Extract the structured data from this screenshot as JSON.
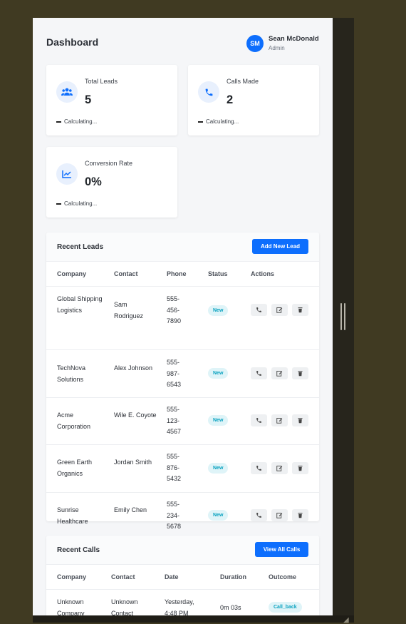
{
  "header": {
    "title": "Dashboard",
    "user": {
      "initials": "SM",
      "name": "Sean McDonald",
      "role": "Admin"
    }
  },
  "stats": [
    {
      "label": "Total Leads",
      "value": "5",
      "trend": "Calculating...",
      "icon": "users-icon"
    },
    {
      "label": "Calls Made",
      "value": "2",
      "trend": "Calculating...",
      "icon": "phone-icon"
    },
    {
      "label": "Conversion Rate",
      "value": "0%",
      "trend": "Calculating...",
      "icon": "chart-line-icon"
    }
  ],
  "recent_leads": {
    "title": "Recent Leads",
    "add_button": "Add New Lead",
    "columns": [
      "Company",
      "Contact",
      "Phone",
      "Status",
      "Actions"
    ],
    "rows": [
      {
        "company": "Global Shipping Logistics",
        "contact": "Sam Rodriguez",
        "phone": "555-456-7890",
        "status": "New"
      },
      {
        "company": "TechNova Solutions",
        "contact": "Alex Johnson",
        "phone": "555-987-6543",
        "status": "New"
      },
      {
        "company": "Acme Corporation",
        "contact": "Wile E. Coyote",
        "phone": "555-123-4567",
        "status": "New"
      },
      {
        "company": "Green Earth Organics",
        "contact": "Jordan Smith",
        "phone": "555-876-5432",
        "status": "New"
      },
      {
        "company": "Sunrise Healthcare",
        "contact": "Emily Chen",
        "phone": "555-234-5678",
        "status": "New"
      }
    ],
    "actions": [
      "call-icon",
      "edit-icon",
      "delete-icon"
    ]
  },
  "recent_calls": {
    "title": "Recent Calls",
    "view_button": "View All Calls",
    "columns": [
      "Company",
      "Contact",
      "Date",
      "Duration",
      "Outcome"
    ],
    "rows": [
      {
        "company": "Unknown Company",
        "contact": "Unknown Contact",
        "date": "Yesterday, 4:48 PM",
        "duration": "0m 03s",
        "outcome": "Call_back"
      }
    ]
  },
  "colors": {
    "primary": "#0d6efd",
    "badge_bg": "#dff4f8",
    "badge_text": "#0aa2c0",
    "page_bg": "#f5f6f8"
  }
}
